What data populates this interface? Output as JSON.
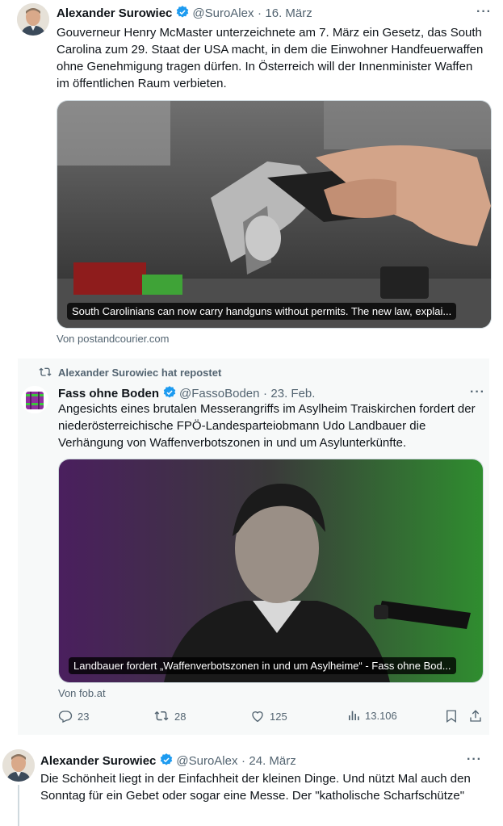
{
  "tweet1": {
    "author_name": "Alexander Surowiec",
    "handle": "@SuroAlex",
    "separator": "·",
    "date": "16. März",
    "more": "···",
    "text": "Gouverneur Henry McMaster unterzeichnete am 7. März ein Gesetz, das South Carolina zum 29. Staat der USA macht, in dem die Einwohner Handfeuerwaffen ohne Genehmigung tragen dürfen. In Österreich will der Innenminister Waffen im öffentlichen Raum verbieten.",
    "card_caption": "South Carolinians can now carry handguns without permits. The new law, explai...",
    "card_source": "Von postandcourier.com"
  },
  "repost": {
    "label": "Alexander Surowiec hat repostet",
    "author_name": "Fass ohne Boden",
    "handle": "@FassoBoden",
    "separator": "·",
    "date": "23. Feb.",
    "more": "···",
    "text": "Angesichts eines brutalen Messerangriffs im Asylheim Traiskirchen fordert der niederösterreichische FPÖ-Landesparteiobmann Udo Landbauer die Verhängung von Waffenverbotszonen in und um Asylunterkünfte.",
    "card_caption": "Landbauer fordert „Waffenverbotszonen in und um Asylheime“ - Fass ohne Bod...",
    "card_source": "Von fob.at",
    "actions": {
      "replies": "23",
      "reposts": "28",
      "likes": "125",
      "views": "13.106"
    }
  },
  "tweet2": {
    "author_name": "Alexander Surowiec",
    "handle": "@SuroAlex",
    "separator": "·",
    "date": "24. März",
    "more": "···",
    "text": "Die Schönheit liegt in der Einfachheit der kleinen Dinge. Und nützt Mal auch den Sonntag für ein Gebet oder sogar eine Messe. Der \"katholische Scharfschütze\""
  },
  "colors": {
    "verified": "#1d9bf0",
    "secondary_text": "#536471",
    "repost_bg": "#f7f9f9"
  }
}
